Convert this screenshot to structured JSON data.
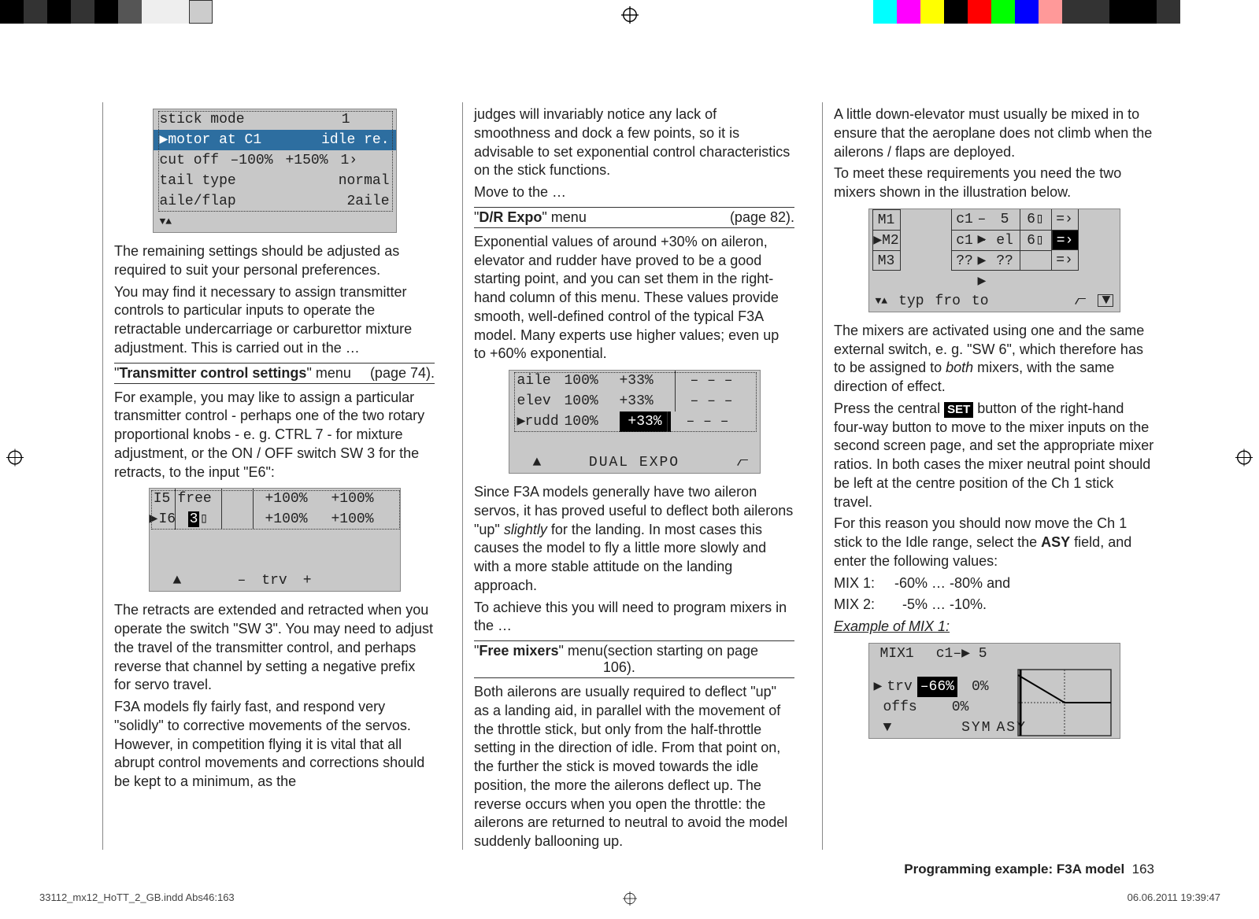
{
  "registration": {
    "top_marker": "⊕",
    "side_markers": "⊕"
  },
  "col1": {
    "lcd1": {
      "r1_label": "stick  mode",
      "r1_val": "1",
      "r2_label": "motor  at  C1",
      "r2_val": "idle  re.",
      "r3_label": "cut  off",
      "r3_v1": "–100%",
      "r3_v2": "+150%",
      "r3_v3": "1›",
      "r4_label": "tail  type",
      "r4_val": "normal",
      "r5_label": "aile/flap",
      "r5_val": "2aile"
    },
    "p1": "The remaining settings should be adjusted as required to suit your personal preferences.",
    "p2": "You may find it necessary to assign transmitter controls to particular inputs to operate the retractable undercarriage or carburettor mixture adjustment. This is carried out in the …",
    "menu1_left_pre": "\"",
    "menu1_left_b": "Transmitter control settings",
    "menu1_left_post": "\" menu",
    "menu1_right": "(page 74).",
    "p3": "For example, you may like to assign a particular transmitter control - perhaps one of the two rotary proportional knobs - e. g. CTRL 7 - for mixture adjustment, or the ON / OFF switch SW 3 for the retracts, to the input \"E6\":",
    "lcd2": {
      "r1_c1": "I5",
      "r1_c2": "free",
      "r1_c3": "",
      "r1_c4": "+100%",
      "r1_c5": "+100%",
      "r2_c1": "I6",
      "r2_c2": "3",
      "r2_c3": "",
      "r2_c4": "+100%",
      "r2_c5": "+100%",
      "foot_mid": "trv",
      "foot_minus": "–",
      "foot_plus": "+"
    },
    "p4": "The retracts are extended and retracted when you operate the switch \"SW 3\". You may need to adjust the travel of the transmitter control, and perhaps reverse that channel by setting a negative prefix for servo travel.",
    "p5": "F3A models fly fairly fast, and respond very \"solidly\" to corrective movements of the servos. However, in competition flying it is vital that all abrupt control movements and corrections should be kept to a minimum, as the"
  },
  "col2": {
    "p1": "judges will invariably notice any lack of smoothness and dock a few points, so it is advisable to set exponential control characteristics on the stick functions.",
    "p2": "Move to the …",
    "menu1_left_pre": "\"",
    "menu1_left_b": "D/R Expo",
    "menu1_left_post": "\" menu",
    "menu1_right": "(page 82).",
    "p3": "Exponential values of around +30% on aileron, elevator and rudder have proved to be a good starting point, and you can set them in the right-hand column of this menu. These values provide smooth, well-defined control of the typical F3A model. Many experts use higher values; even up to +60% exponential.",
    "lcd1": {
      "r1_c1": "aile",
      "r1_c2": "100%",
      "r1_c3": "+33%",
      "r1_c4": "– – –",
      "r2_c1": "elev",
      "r2_c2": "100%",
      "r2_c3": "+33%",
      "r2_c4": "– – –",
      "r3_c1": "rudd",
      "r3_c2": "100%",
      "r3_c3": "+33%",
      "r3_c4": "– – –",
      "foot": "DUAL   EXPO"
    },
    "p4_pre": "Since F3A models generally have two aileron servos, it has proved useful to deflect both ailerons \"up\" ",
    "p4_i": "slightly",
    "p4_post": " for the landing. In most cases this causes the model to fly a little more slowly and with a more stable attitude on the landing approach.",
    "p5": "To achieve this you will need to program mixers in the …",
    "menu2_left_pre": "\"",
    "menu2_left_b": "Free mixers",
    "menu2_left_post": "\" menu",
    "menu2_right": "(section starting on page 106).",
    "p6": "Both ailerons are usually required to deflect \"up\" as a landing aid, in parallel with the movement of the throttle stick, but only from the half-throttle setting in the direction of idle. From that point on, the further the stick is moved towards the idle position, the more the ailerons deflect up. The reverse occurs when you open the throttle: the ailerons are returned to neutral to avoid the model suddenly ballooning up."
  },
  "col3": {
    "p1": "A little down-elevator must usually be mixed in to ensure that the aeroplane does not climb when the ailerons / flaps are deployed.",
    "p2": "To meet these requirements you need the two mixers shown in the illustration below.",
    "lcd1": {
      "r1_c1": "M1",
      "r1_c2": "",
      "r1_c3": "c1",
      "r1_c4": "5",
      "r1_c5": "6",
      "r1_c6": "=›",
      "r2_c1": "M2",
      "r2_c2": "",
      "r2_c3": "c1",
      "r2_c4": "el",
      "r2_c5": "6",
      "r2_c6": "=›",
      "r3_c1": "M3",
      "r3_c2": "",
      "r3_c3": "??",
      "r3_c4": "??",
      "r3_c5": "",
      "r3_c6": "=›",
      "foot_typ": "typ",
      "foot_fro": "fro",
      "foot_to": "to"
    },
    "p3_pre": "The mixers are activated using one and the same external switch, e. g. \"SW 6\", which therefore has to be assigned to ",
    "p3_i": "both",
    "p3_post": " mixers, with the same direction of effect.",
    "p4_pre": "Press the central ",
    "p4_set": "SET",
    "p4_post": " button of the right-hand four-way button to move to the mixer inputs on the second screen page, and set the appropriate mixer ratios. In both cases the mixer neutral point should be left at the centre position of the Ch 1 stick travel.",
    "p5_pre": "For this reason you should now move the Ch 1 stick to the Idle range, select the ",
    "p5_b": "ASY",
    "p5_post": " field, and enter the following values:",
    "mix1": "MIX 1:     -60% … -80% and",
    "mix2": "MIX 2:       -5% … -10%.",
    "example": "Example of MIX 1:",
    "lcd2": {
      "title_l": "MIX1",
      "title_r": "c1",
      "title_5": "5",
      "trv_lbl": "trv",
      "trv_v1": "–66%",
      "trv_v2": "0%",
      "offs_lbl": "offs",
      "offs_v": "0%",
      "foot_sym": "SYM",
      "foot_asy": "ASY"
    }
  },
  "footer": {
    "title": "Programming example: F3A model",
    "pagenum": "163"
  },
  "meta": {
    "left": "33112_mx12_HoTT_2_GB.indd   Abs46:163",
    "right": "06.06.2011   19:39:47"
  }
}
